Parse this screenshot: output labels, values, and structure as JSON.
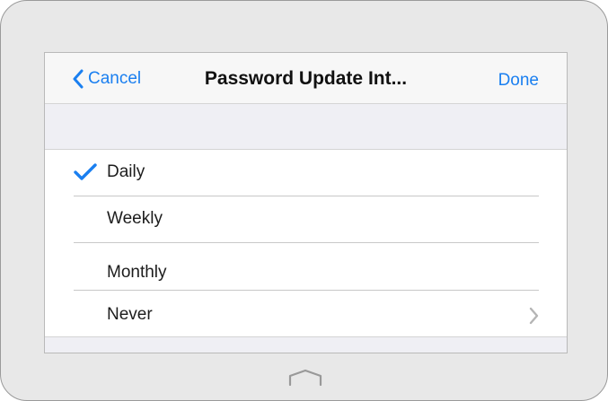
{
  "navbar": {
    "back_label": "Cancel",
    "title": "Password Update Int...",
    "done_label": "Done",
    "back_icon": "chevron-left-icon"
  },
  "options": [
    {
      "label": "Daily",
      "selected": true
    },
    {
      "label": "Weekly",
      "selected": false
    },
    {
      "label": "Monthly",
      "selected": false
    },
    {
      "label": "Never",
      "selected": false,
      "has_disclosure": true
    }
  ],
  "icons": {
    "selected": "checkmark-icon",
    "disclosure": "chevron-right-icon",
    "home": "home-button-icon"
  },
  "colors": {
    "accent": "#1a7ff0",
    "separator": "#c8c8c8",
    "grouped_background": "#efeff4",
    "device_frame": "#e8e8e8"
  }
}
